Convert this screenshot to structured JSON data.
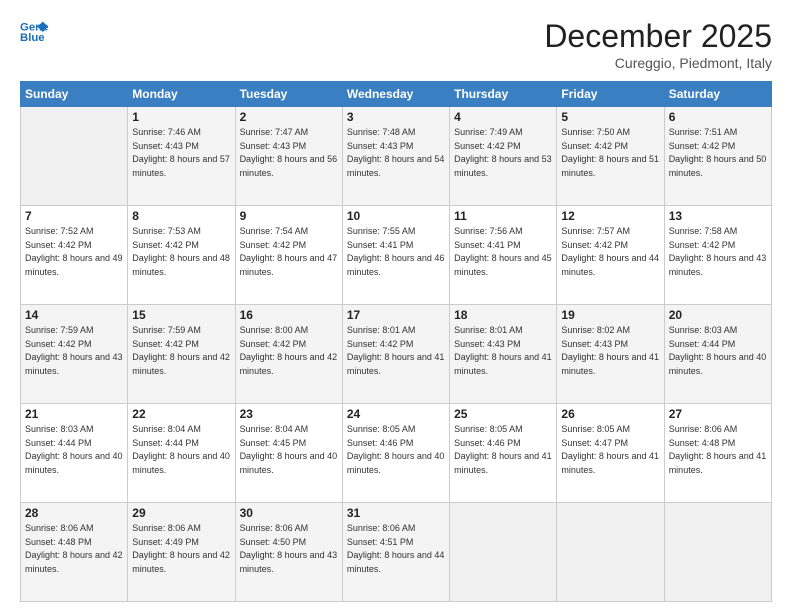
{
  "header": {
    "logo_line1": "General",
    "logo_line2": "Blue",
    "month_title": "December 2025",
    "location": "Cureggio, Piedmont, Italy"
  },
  "days_of_week": [
    "Sunday",
    "Monday",
    "Tuesday",
    "Wednesday",
    "Thursday",
    "Friday",
    "Saturday"
  ],
  "weeks": [
    [
      {
        "day": "",
        "sunrise": "",
        "sunset": "",
        "daylight": ""
      },
      {
        "day": "1",
        "sunrise": "Sunrise: 7:46 AM",
        "sunset": "Sunset: 4:43 PM",
        "daylight": "Daylight: 8 hours and 57 minutes."
      },
      {
        "day": "2",
        "sunrise": "Sunrise: 7:47 AM",
        "sunset": "Sunset: 4:43 PM",
        "daylight": "Daylight: 8 hours and 56 minutes."
      },
      {
        "day": "3",
        "sunrise": "Sunrise: 7:48 AM",
        "sunset": "Sunset: 4:43 PM",
        "daylight": "Daylight: 8 hours and 54 minutes."
      },
      {
        "day": "4",
        "sunrise": "Sunrise: 7:49 AM",
        "sunset": "Sunset: 4:42 PM",
        "daylight": "Daylight: 8 hours and 53 minutes."
      },
      {
        "day": "5",
        "sunrise": "Sunrise: 7:50 AM",
        "sunset": "Sunset: 4:42 PM",
        "daylight": "Daylight: 8 hours and 51 minutes."
      },
      {
        "day": "6",
        "sunrise": "Sunrise: 7:51 AM",
        "sunset": "Sunset: 4:42 PM",
        "daylight": "Daylight: 8 hours and 50 minutes."
      }
    ],
    [
      {
        "day": "7",
        "sunrise": "Sunrise: 7:52 AM",
        "sunset": "Sunset: 4:42 PM",
        "daylight": "Daylight: 8 hours and 49 minutes."
      },
      {
        "day": "8",
        "sunrise": "Sunrise: 7:53 AM",
        "sunset": "Sunset: 4:42 PM",
        "daylight": "Daylight: 8 hours and 48 minutes."
      },
      {
        "day": "9",
        "sunrise": "Sunrise: 7:54 AM",
        "sunset": "Sunset: 4:42 PM",
        "daylight": "Daylight: 8 hours and 47 minutes."
      },
      {
        "day": "10",
        "sunrise": "Sunrise: 7:55 AM",
        "sunset": "Sunset: 4:41 PM",
        "daylight": "Daylight: 8 hours and 46 minutes."
      },
      {
        "day": "11",
        "sunrise": "Sunrise: 7:56 AM",
        "sunset": "Sunset: 4:41 PM",
        "daylight": "Daylight: 8 hours and 45 minutes."
      },
      {
        "day": "12",
        "sunrise": "Sunrise: 7:57 AM",
        "sunset": "Sunset: 4:42 PM",
        "daylight": "Daylight: 8 hours and 44 minutes."
      },
      {
        "day": "13",
        "sunrise": "Sunrise: 7:58 AM",
        "sunset": "Sunset: 4:42 PM",
        "daylight": "Daylight: 8 hours and 43 minutes."
      }
    ],
    [
      {
        "day": "14",
        "sunrise": "Sunrise: 7:59 AM",
        "sunset": "Sunset: 4:42 PM",
        "daylight": "Daylight: 8 hours and 43 minutes."
      },
      {
        "day": "15",
        "sunrise": "Sunrise: 7:59 AM",
        "sunset": "Sunset: 4:42 PM",
        "daylight": "Daylight: 8 hours and 42 minutes."
      },
      {
        "day": "16",
        "sunrise": "Sunrise: 8:00 AM",
        "sunset": "Sunset: 4:42 PM",
        "daylight": "Daylight: 8 hours and 42 minutes."
      },
      {
        "day": "17",
        "sunrise": "Sunrise: 8:01 AM",
        "sunset": "Sunset: 4:42 PM",
        "daylight": "Daylight: 8 hours and 41 minutes."
      },
      {
        "day": "18",
        "sunrise": "Sunrise: 8:01 AM",
        "sunset": "Sunset: 4:43 PM",
        "daylight": "Daylight: 8 hours and 41 minutes."
      },
      {
        "day": "19",
        "sunrise": "Sunrise: 8:02 AM",
        "sunset": "Sunset: 4:43 PM",
        "daylight": "Daylight: 8 hours and 41 minutes."
      },
      {
        "day": "20",
        "sunrise": "Sunrise: 8:03 AM",
        "sunset": "Sunset: 4:44 PM",
        "daylight": "Daylight: 8 hours and 40 minutes."
      }
    ],
    [
      {
        "day": "21",
        "sunrise": "Sunrise: 8:03 AM",
        "sunset": "Sunset: 4:44 PM",
        "daylight": "Daylight: 8 hours and 40 minutes."
      },
      {
        "day": "22",
        "sunrise": "Sunrise: 8:04 AM",
        "sunset": "Sunset: 4:44 PM",
        "daylight": "Daylight: 8 hours and 40 minutes."
      },
      {
        "day": "23",
        "sunrise": "Sunrise: 8:04 AM",
        "sunset": "Sunset: 4:45 PM",
        "daylight": "Daylight: 8 hours and 40 minutes."
      },
      {
        "day": "24",
        "sunrise": "Sunrise: 8:05 AM",
        "sunset": "Sunset: 4:46 PM",
        "daylight": "Daylight: 8 hours and 40 minutes."
      },
      {
        "day": "25",
        "sunrise": "Sunrise: 8:05 AM",
        "sunset": "Sunset: 4:46 PM",
        "daylight": "Daylight: 8 hours and 41 minutes."
      },
      {
        "day": "26",
        "sunrise": "Sunrise: 8:05 AM",
        "sunset": "Sunset: 4:47 PM",
        "daylight": "Daylight: 8 hours and 41 minutes."
      },
      {
        "day": "27",
        "sunrise": "Sunrise: 8:06 AM",
        "sunset": "Sunset: 4:48 PM",
        "daylight": "Daylight: 8 hours and 41 minutes."
      }
    ],
    [
      {
        "day": "28",
        "sunrise": "Sunrise: 8:06 AM",
        "sunset": "Sunset: 4:48 PM",
        "daylight": "Daylight: 8 hours and 42 minutes."
      },
      {
        "day": "29",
        "sunrise": "Sunrise: 8:06 AM",
        "sunset": "Sunset: 4:49 PM",
        "daylight": "Daylight: 8 hours and 42 minutes."
      },
      {
        "day": "30",
        "sunrise": "Sunrise: 8:06 AM",
        "sunset": "Sunset: 4:50 PM",
        "daylight": "Daylight: 8 hours and 43 minutes."
      },
      {
        "day": "31",
        "sunrise": "Sunrise: 8:06 AM",
        "sunset": "Sunset: 4:51 PM",
        "daylight": "Daylight: 8 hours and 44 minutes."
      },
      {
        "day": "",
        "sunrise": "",
        "sunset": "",
        "daylight": ""
      },
      {
        "day": "",
        "sunrise": "",
        "sunset": "",
        "daylight": ""
      },
      {
        "day": "",
        "sunrise": "",
        "sunset": "",
        "daylight": ""
      }
    ]
  ]
}
